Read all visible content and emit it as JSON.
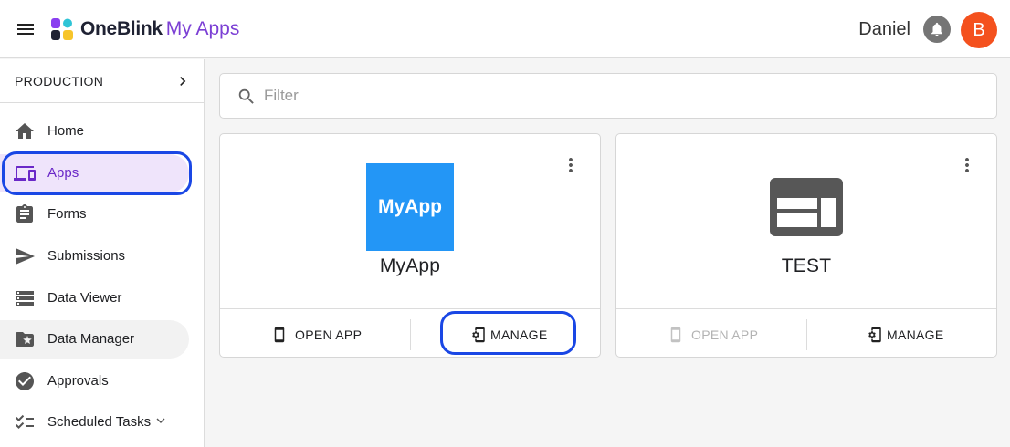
{
  "header": {
    "brand_main": "OneBlink",
    "brand_sub": "My Apps",
    "username": "Daniel",
    "avatar_initial": "B",
    "avatar_color": "#f4511e",
    "brand_color": "#7b3fd4"
  },
  "sidebar": {
    "environment": "PRODUCTION",
    "items": [
      {
        "label": "Home",
        "icon": "home-icon"
      },
      {
        "label": "Apps",
        "icon": "devices-icon",
        "selected": true
      },
      {
        "label": "Forms",
        "icon": "clipboard-icon"
      },
      {
        "label": "Submissions",
        "icon": "send-icon"
      },
      {
        "label": "Data Viewer",
        "icon": "storage-icon"
      },
      {
        "label": "Data Manager",
        "icon": "folder-special-icon"
      },
      {
        "label": "Approvals",
        "icon": "check-circle-icon"
      },
      {
        "label": "Scheduled Tasks",
        "icon": "checklist-icon"
      }
    ],
    "selected_color": "#6a28c8"
  },
  "filter": {
    "placeholder": "Filter"
  },
  "cards": [
    {
      "name": "MyApp",
      "logo_text": "MyApp",
      "logo_color": "#2396f6",
      "open_label": "OPEN APP",
      "manage_label": "MANAGE",
      "open_enabled": true
    },
    {
      "name": "TEST",
      "open_label": "OPEN APP",
      "manage_label": "MANAGE",
      "open_enabled": false
    }
  ],
  "highlight_color": "#1a47e5"
}
